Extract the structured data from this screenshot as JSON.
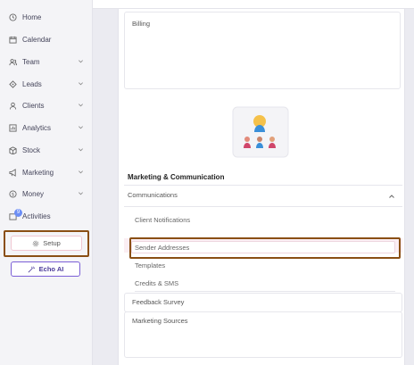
{
  "sidebar": {
    "items": [
      {
        "label": "Home",
        "icon": "clock-icon",
        "chevron": false
      },
      {
        "label": "Calendar",
        "icon": "calendar-icon",
        "chevron": false
      },
      {
        "label": "Team",
        "icon": "team-icon",
        "chevron": true
      },
      {
        "label": "Leads",
        "icon": "leads-icon",
        "chevron": true
      },
      {
        "label": "Clients",
        "icon": "user-icon",
        "chevron": true
      },
      {
        "label": "Analytics",
        "icon": "analytics-icon",
        "chevron": true
      },
      {
        "label": "Stock",
        "icon": "stock-icon",
        "chevron": true
      },
      {
        "label": "Marketing",
        "icon": "megaphone-icon",
        "chevron": true
      },
      {
        "label": "Money",
        "icon": "money-icon",
        "chevron": true
      },
      {
        "label": "Activities",
        "icon": "activities-icon",
        "chevron": false,
        "badge": "9"
      }
    ],
    "setup_label": "Setup",
    "echo_label": "Echo AI"
  },
  "main": {
    "billing_title": "Billing",
    "section_title": "Marketing & Communication",
    "communications": {
      "label": "Communications",
      "expanded": true,
      "items": [
        "Client Notifications",
        "Sender Addresses",
        "Templates",
        "Credits & SMS"
      ]
    },
    "cards": [
      "Feedback Survey",
      "Marketing Sources"
    ]
  },
  "colors": {
    "highlight_border": "#8a4f14",
    "echo_accent": "#7b5fd6",
    "highlight_bg": "#fbeef3"
  }
}
